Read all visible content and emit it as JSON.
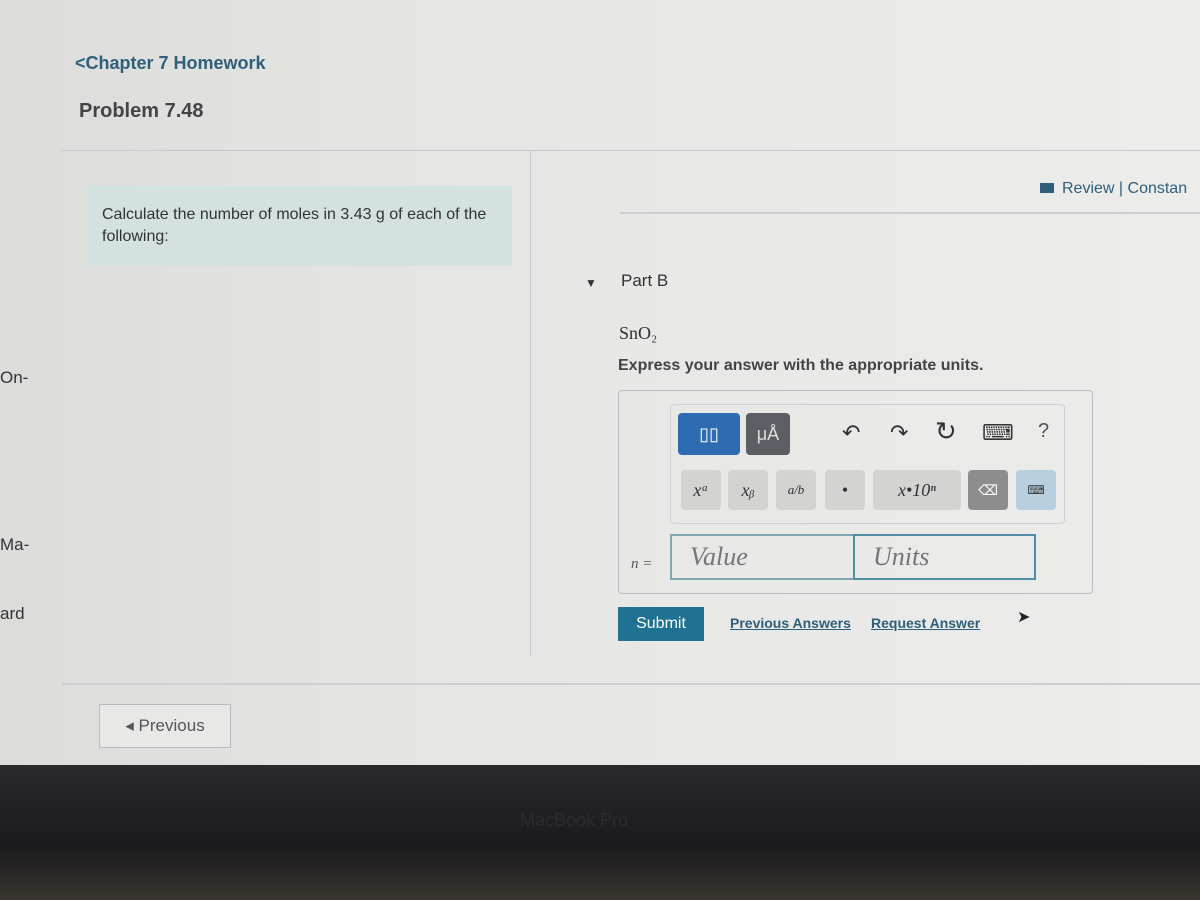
{
  "edge_fragments": [
    "On-",
    "Ma-",
    "ard"
  ],
  "header": {
    "back_link": "Chapter 7 Homework",
    "title": "Problem 7.48"
  },
  "intro": {
    "text": "Calculate the number of moles in 3.43 g of each of the following:"
  },
  "review": {
    "label": "Review | Constan"
  },
  "part": {
    "label": "Part B",
    "formula": "SnO₂",
    "instructions": "Express your answer with the appropriate units."
  },
  "toolbar": {
    "templates": "▯▯",
    "units": "μÅ",
    "undo": "↶",
    "redo": "↷",
    "reset": "↻",
    "keyboard": "⌨",
    "help": "?",
    "superscript": "xᵃ",
    "subscript": "xᵦ",
    "fraction": "a/b",
    "dot": "•",
    "sci": "x•10ⁿ",
    "delete": "⌫",
    "show_keyboard": "⌨"
  },
  "answer": {
    "variable": "n =",
    "value_placeholder": "Value",
    "units_placeholder": "Units"
  },
  "actions": {
    "submit": "Submit",
    "previous_answers": "Previous Answers",
    "request_answer": "Request Answer"
  },
  "nav": {
    "previous": "◂ Previous"
  },
  "device": {
    "label": "MacBook Pro"
  },
  "colors": {
    "link": "#2f5f7a",
    "submit": "#1f7291",
    "intro_bg": "#d3e1e1",
    "template_btn": "#2f6bb0"
  }
}
